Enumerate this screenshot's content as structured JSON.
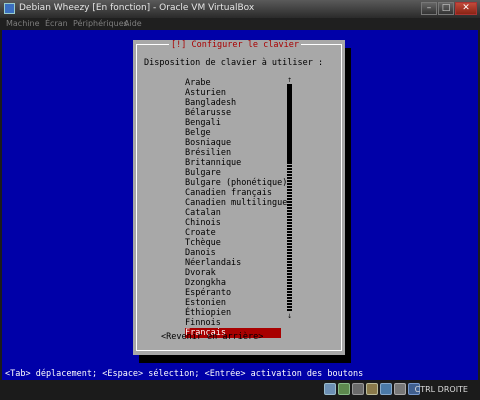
{
  "window": {
    "title": "Debian Wheezy [En fonction] - Oracle VM VirtualBox",
    "controls": {
      "minimize": "–",
      "maximize": "□",
      "close": "✕"
    }
  },
  "menu": [
    "Machine",
    "Écran",
    "Périphériques",
    "Aide"
  ],
  "dialog": {
    "title": "[!] Configurer le clavier",
    "prompt": "Disposition de clavier à utiliser :",
    "items": [
      "Arabe",
      "Asturien",
      "Bangladesh",
      "Bélarusse",
      "Bengali",
      "Belge",
      "Bosniaque",
      "Brésilien",
      "Britannique",
      "Bulgare",
      "Bulgare (phonétique)",
      "Canadien français",
      "Canadien multilingue",
      "Catalan",
      "Chinois",
      "Croate",
      "Tchèque",
      "Danois",
      "Néerlandais",
      "Dvorak",
      "Dzongkha",
      "Espéranto",
      "Estonien",
      "Éthiopien",
      "Finnois",
      "Français"
    ],
    "selected_index": 25,
    "back_label": "<Revenir en arrière>",
    "scroll_up": "↑",
    "scroll_down": "↓"
  },
  "help_line": "<Tab> déplacement; <Espace> sélection; <Entrée> activation des boutons",
  "status": {
    "host_key": "CTRL DROITE",
    "icons": [
      "hard-disk-icon",
      "optical-drive-icon",
      "usb-icon",
      "shared-folders-icon",
      "network-icon",
      "display-icon",
      "capture-icon"
    ]
  },
  "colors": {
    "screen_bg": "#0000a8",
    "dialog_bg": "#a8a8a8",
    "selection": "#a80000",
    "title_red": "#a80000"
  }
}
